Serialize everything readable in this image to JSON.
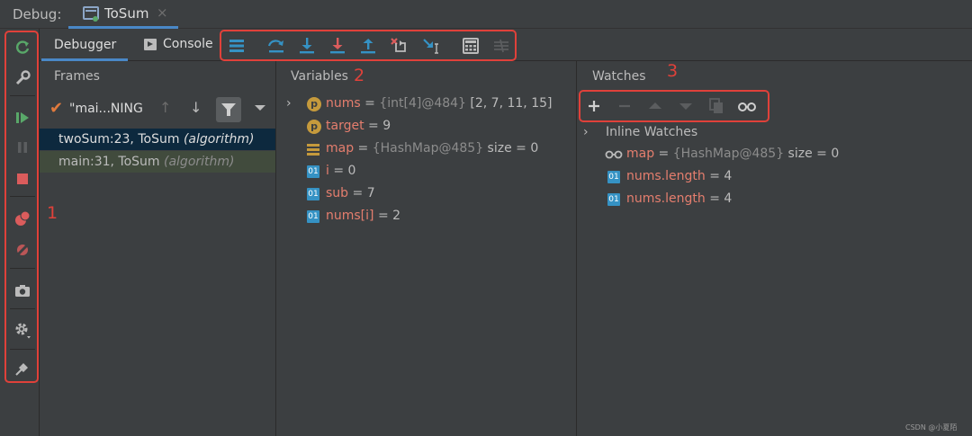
{
  "topbar": {
    "debug_label": "Debug:",
    "tab_label": "ToSum",
    "tab_close": "×"
  },
  "tabs": {
    "debugger": "Debugger",
    "console": "Console"
  },
  "panels": {
    "frames": "Frames",
    "variables": "Variables",
    "watches": "Watches"
  },
  "annotations": {
    "one": "1",
    "two": "2",
    "three": "3"
  },
  "frames": {
    "thread": "\"mai...NING",
    "items": [
      {
        "method": "twoSum:23, ToSum",
        "package": "(algorithm)"
      },
      {
        "method": "main:31, ToSum",
        "package": "(algorithm)"
      }
    ]
  },
  "variables": [
    {
      "icon": "p-icon",
      "name": "nums",
      "op": " = ",
      "type": "{int[4]@484}",
      "value": " [2, 7, 11, 15]",
      "expandable": true
    },
    {
      "icon": "p-icon",
      "name": "target",
      "op": " = ",
      "type": "",
      "value": "9",
      "expandable": false
    },
    {
      "icon": "map-icon",
      "name": "map",
      "op": " = ",
      "type": "{HashMap@485}",
      "value": "  size = 0",
      "expandable": false
    },
    {
      "icon": "field-icon",
      "name": "i",
      "op": " = ",
      "type": "",
      "value": "0",
      "expandable": false
    },
    {
      "icon": "field-icon",
      "name": "sub",
      "op": " = ",
      "type": "",
      "value": "7",
      "expandable": false
    },
    {
      "icon": "field-icon",
      "name": "nums[i]",
      "op": " = ",
      "type": "",
      "value": "2",
      "expandable": false
    }
  ],
  "watches": {
    "inline_label": "Inline Watches",
    "items": [
      {
        "icon": "glasses-icon",
        "name": "map",
        "op": " = ",
        "type": "{HashMap@485}",
        "value": "  size = 0"
      },
      {
        "icon": "field-icon",
        "name": "nums.length",
        "op": " = ",
        "type": "",
        "value": "4"
      },
      {
        "icon": "field-icon",
        "name": "nums.length",
        "op": " = ",
        "type": "",
        "value": "4"
      }
    ]
  },
  "icon_labels": {
    "p": "p",
    "field": "01"
  },
  "watermark": "CSDN @小夏陌",
  "colors": {
    "accent": "#4a88c7",
    "annotation": "#e0413a",
    "var_name": "#e57e6e",
    "selected_frame": "#0d293e"
  }
}
